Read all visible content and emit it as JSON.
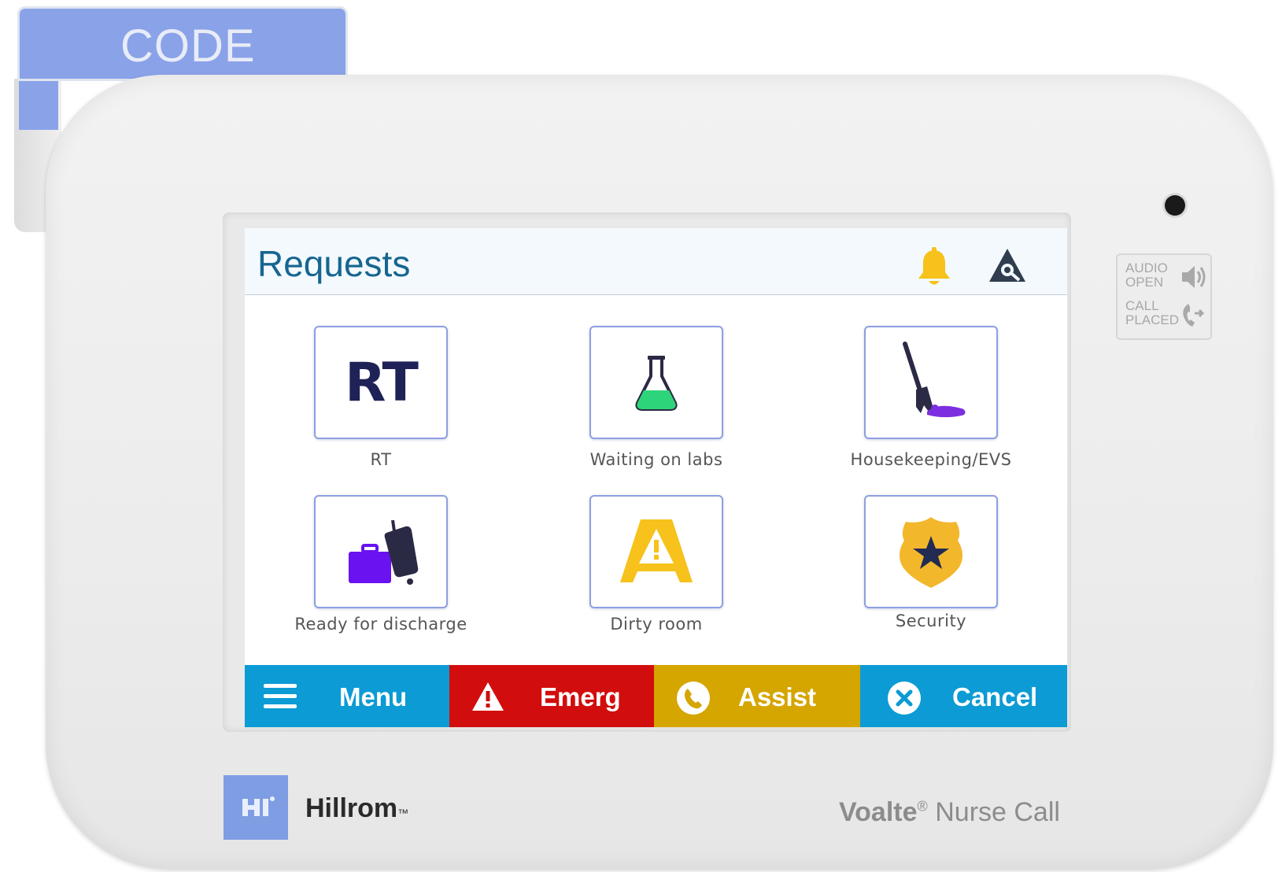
{
  "device": {
    "code_tab_label": "CODE",
    "indicators": [
      {
        "label": "AUDIO\nOPEN",
        "icon": "speaker-icon"
      },
      {
        "label": "CALL\nPLACED",
        "icon": "phone-call-icon"
      }
    ],
    "brand": {
      "name": "Hillrom",
      "mark": "™"
    },
    "product": {
      "name_bold": "Voalte",
      "registered": "®",
      "name_rest": " Nurse Call"
    }
  },
  "header": {
    "title": "Requests",
    "icons": [
      "bell-icon",
      "alert-icon"
    ],
    "bell_color": "#f6c21b",
    "alert_color": "#2f3d4f"
  },
  "requests": [
    {
      "label": "RT",
      "icon": "rt-text-icon",
      "icon_text": "RT"
    },
    {
      "label": "Waiting on labs",
      "icon": "lab-flask-icon"
    },
    {
      "label": "Housekeeping/EVS",
      "icon": "mop-icon"
    },
    {
      "label": "Ready for discharge",
      "icon": "luggage-icon"
    },
    {
      "label": "Dirty room",
      "icon": "wet-floor-sign-icon"
    },
    {
      "label": "Security",
      "icon": "security-badge-icon"
    }
  ],
  "actions": [
    {
      "label": "Menu",
      "icon": "hamburger-menu-icon",
      "color": "#0c9bd4"
    },
    {
      "label": "Emerg",
      "icon": "warning-icon",
      "color": "#d20d0d"
    },
    {
      "label": "Assist",
      "icon": "phone-icon",
      "color": "#d5a500"
    },
    {
      "label": "Cancel",
      "icon": "cancel-circle-icon",
      "color": "#0c9bd4"
    }
  ]
}
